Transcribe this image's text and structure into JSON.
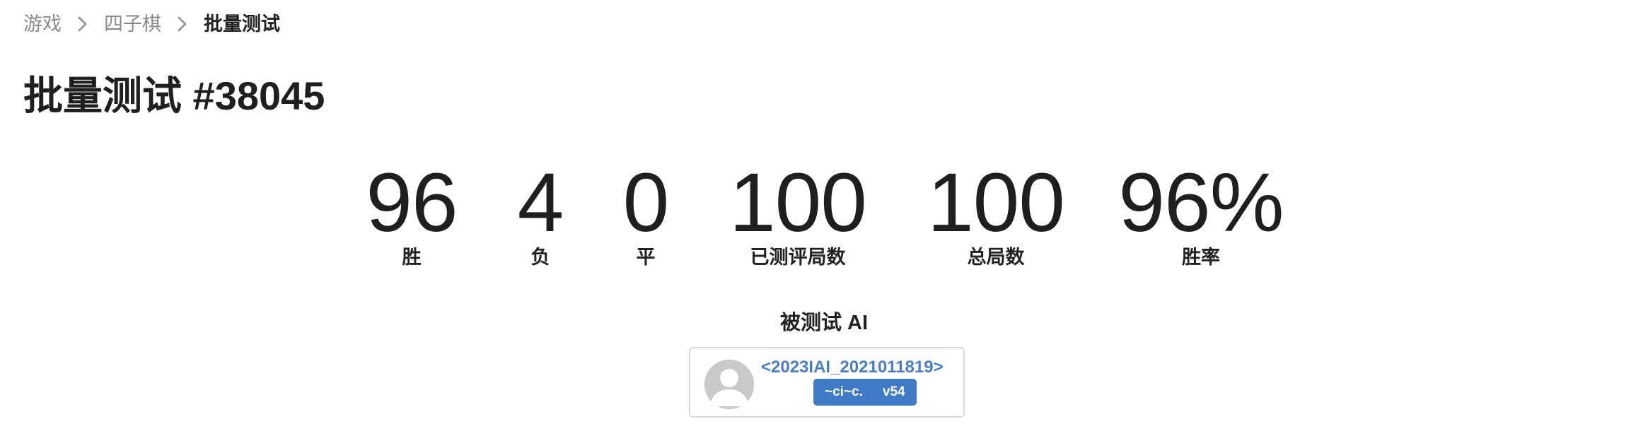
{
  "breadcrumb": {
    "items": [
      {
        "label": "游戏"
      },
      {
        "label": "四子棋"
      },
      {
        "label": "批量测试"
      }
    ]
  },
  "page": {
    "title": "批量测试 #38045"
  },
  "stats": [
    {
      "value": "96",
      "label": "胜"
    },
    {
      "value": "4",
      "label": "负"
    },
    {
      "value": "0",
      "label": "平"
    },
    {
      "value": "100",
      "label": "已测评局数"
    },
    {
      "value": "100",
      "label": "总局数"
    },
    {
      "value": "96%",
      "label": "胜率"
    }
  ],
  "tested_ai": {
    "heading": "被测试 AI",
    "name": "<2023IAI_2021011819>",
    "user": "~ci~c.",
    "version": "v54",
    "avatar_icon": "default-user-avatar-icon"
  },
  "colors": {
    "link": "#4a7fc1",
    "badge": "#3f7ac4",
    "muted": "#8a8a8a"
  }
}
